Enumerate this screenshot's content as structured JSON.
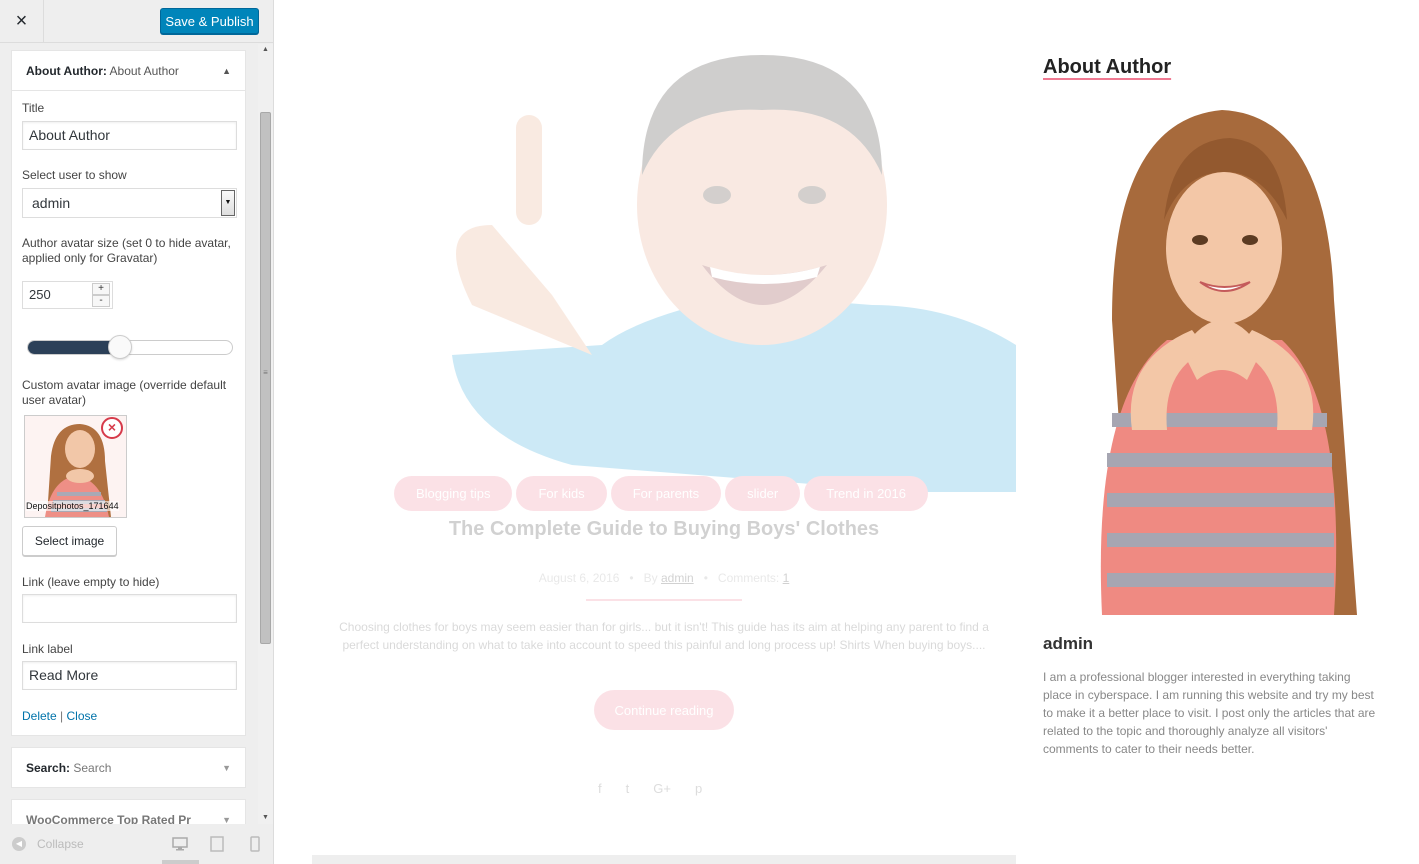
{
  "header": {
    "close_label": "×",
    "save_label": "Save & Publish"
  },
  "widget": {
    "type": "About Author:",
    "name": "About Author",
    "fields": {
      "title_label": "Title",
      "title_value": "About Author",
      "user_label": "Select user to show",
      "user_value": "admin",
      "size_label": "Author avatar size (set 0 to hide avatar, applied only for Gravatar)",
      "size_value": "250",
      "size_slider_fraction": 0.45,
      "custom_avatar_label": "Custom avatar image (override default user avatar)",
      "avatar_caption": "Depositphotos_171644",
      "select_image_label": "Select image",
      "link_label": "Link (leave empty to hide)",
      "link_value": "",
      "link_text_label": "Link label",
      "link_text_value": "Read More",
      "delete_label": "Delete",
      "separator": "|",
      "close_label": "Close"
    }
  },
  "other_widgets": [
    {
      "type": "Search:",
      "name": "Search"
    },
    {
      "type": "WooCommerce Top Rated Pr",
      "name": ""
    }
  ],
  "footer": {
    "collapse_label": "Collapse"
  },
  "preview": {
    "tags": [
      "Blogging tips",
      "For kids",
      "For parents",
      "slider",
      "Trend in 2016"
    ],
    "post_title": "The Complete Guide to Buying Boys' Clothes",
    "date": "August 6, 2016",
    "by_label": "By",
    "author": "admin",
    "comments_label": "Comments:",
    "comments_count": "1",
    "excerpt": "Choosing clothes for boys may seem easier than for girls... but it isn't! This guide has its aim at helping any parent to find a perfect understanding on what to take into account to speed this painful and long process up! Shirts When buying boys....",
    "continue_label": "Continue reading",
    "sidebar_title": "About Author",
    "author_name": "admin",
    "bio": "I am a professional blogger interested in everything taking place in cyberspace. I am running this website and try my best to make it a better place to visit. I post only the articles that are related to the topic and thoroughly analyze all visitors' comments to cater to their needs better."
  },
  "colors": {
    "accent": "#0085ba",
    "pink": "#f07a92",
    "slider": "#2c4058"
  }
}
